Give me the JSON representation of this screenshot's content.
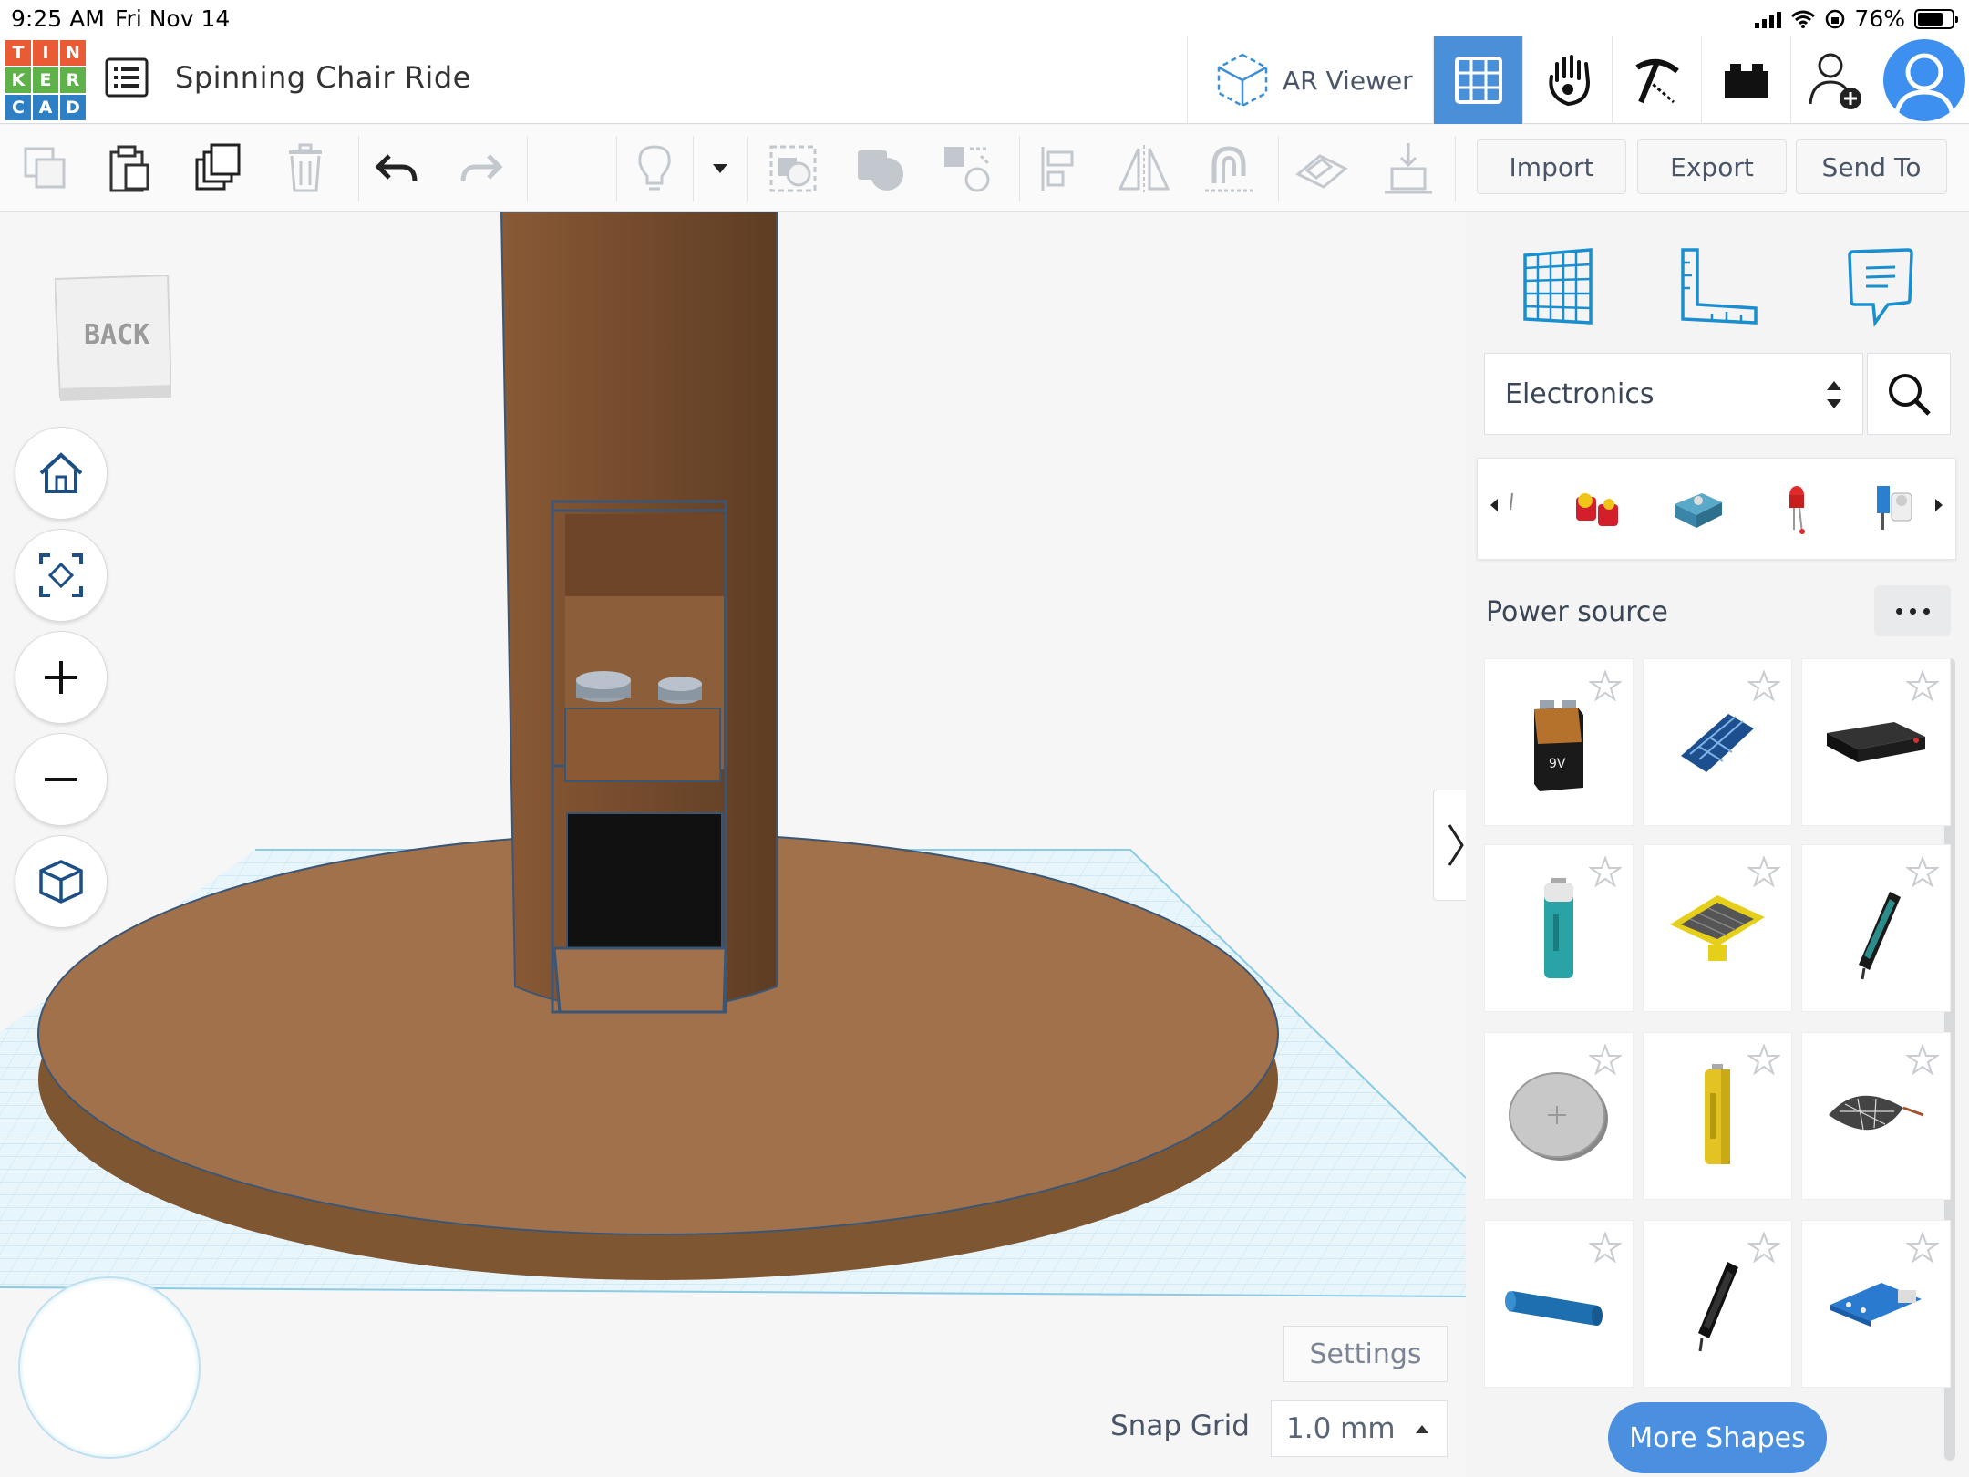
{
  "status_bar": {
    "time": "9:25 AM",
    "date": "Fri Nov 14",
    "battery_text": "76%",
    "battery_level": 0.76
  },
  "header": {
    "logo_letters": [
      "T",
      "I",
      "N",
      "K",
      "E",
      "R",
      "C",
      "A",
      "D"
    ],
    "logo_colors": [
      "#e85b34",
      "#e85b34",
      "#e85b34",
      "#5fb24a",
      "#5fb24a",
      "#5fb24a",
      "#2f7fc4",
      "#2f7fc4",
      "#2f7fc4"
    ],
    "project_title": "Spinning Chair Ride",
    "ar_viewer_label": "AR Viewer",
    "views": [
      "3d-design-grid-icon",
      "codeblocks-hand-icon",
      "blocks-pickaxe-icon",
      "bricks-icon"
    ],
    "active_view": "3d-design-grid-icon",
    "accent_color": "#4a90d9"
  },
  "toolbar": {
    "left_icons": [
      "copy-icon",
      "paste-icon",
      "duplicate-icon",
      "delete-icon",
      "undo-icon",
      "redo-icon"
    ],
    "center_icons": [
      "light-bulb-icon",
      "show-all-icon",
      "group-icon",
      "ungroup-icon",
      "align-icon",
      "mirror-icon",
      "cruise-magnet-icon",
      "workplane-icon",
      "drop-icon"
    ],
    "import_label": "Import",
    "export_label": "Export",
    "send_to_label": "Send To"
  },
  "viewcube": {
    "face_label": "BACK"
  },
  "view_controls": [
    "home-icon",
    "fit-view-icon",
    "zoom-in-icon",
    "zoom-out-icon",
    "ortho-cube-icon"
  ],
  "canvas": {
    "settings_label": "Settings",
    "snap_grid_label": "Snap Grid",
    "snap_grid_value": "1.0 mm"
  },
  "panel": {
    "top_icons": [
      "workplane-grid-icon",
      "ruler-icon",
      "notes-icon"
    ],
    "category": "Electronics",
    "carousel_items": [
      "motor-red-icon",
      "servo-blue-icon",
      "led-red-icon",
      "sensor-module-icon"
    ],
    "section_title": "Power source",
    "shapes": [
      "9v-battery",
      "solar-panel-blue",
      "battery-pack-black",
      "aa-battery-teal",
      "solar-panel-yellow",
      "battery-holder-single",
      "coin-cell",
      "aa-battery-yellow",
      "leaf-solar-cell",
      "cylinder-battery-blue",
      "battery-holder-black",
      "power-module-blue"
    ],
    "more_shapes_label": "More Shapes"
  }
}
